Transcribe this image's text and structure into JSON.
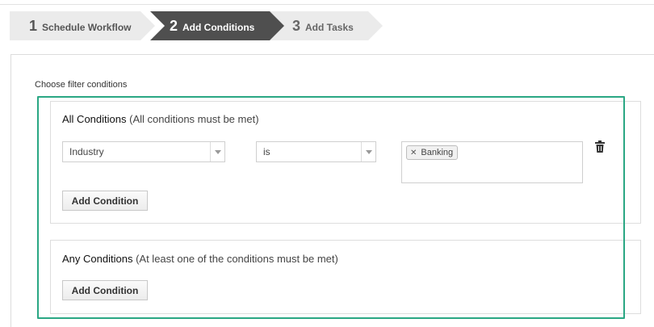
{
  "wizard": {
    "steps": [
      {
        "number": "1",
        "label": "Schedule Workflow",
        "state": "inactive"
      },
      {
        "number": "2",
        "label": "Add Conditions",
        "state": "active"
      },
      {
        "number": "3",
        "label": "Add Tasks",
        "state": "inactive"
      }
    ]
  },
  "form": {
    "heading": "Choose filter conditions",
    "all_conditions": {
      "title": "All Conditions",
      "subtitle": "(All conditions must be met)",
      "row": {
        "field": "Industry",
        "operator": "is",
        "values": [
          "Banking"
        ]
      },
      "add_button": "Add Condition"
    },
    "any_conditions": {
      "title": "Any Conditions",
      "subtitle": "(At least one of the conditions must be met)",
      "add_button": "Add Condition"
    }
  },
  "colors": {
    "active_step": "#4f4f4f",
    "inactive_step": "#ebebeb",
    "highlight_border": "#2aa784"
  },
  "icons": [
    "trash-icon",
    "close-icon",
    "chevron-down-icon"
  ]
}
